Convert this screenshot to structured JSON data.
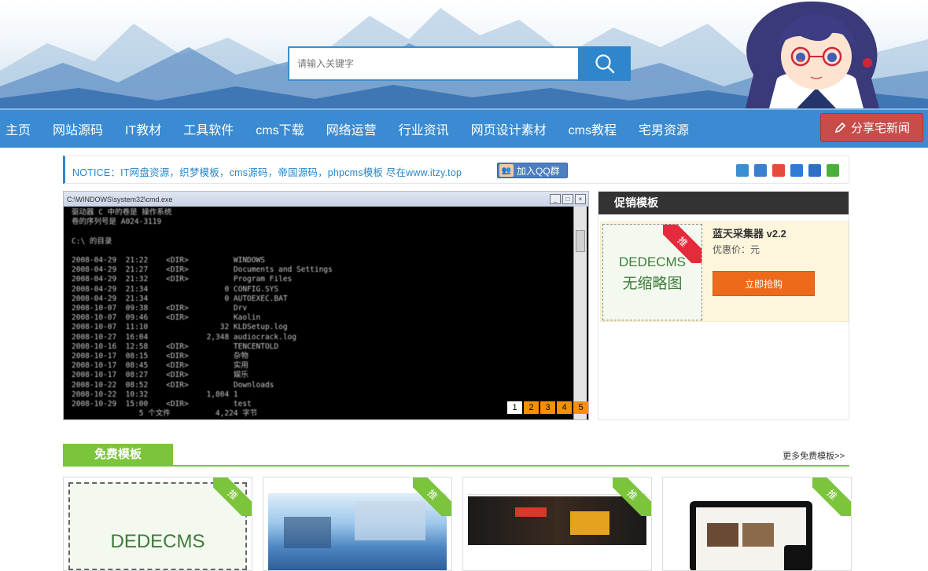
{
  "search": {
    "placeholder": "请输入关键字"
  },
  "nav": {
    "items": [
      "主页",
      "网站源码",
      "IT教材",
      "工具软件",
      "cms下载",
      "网络运营",
      "行业资讯",
      "网页设计素材",
      "cms教程",
      "宅男资源"
    ],
    "share_label": "分享宅新闻"
  },
  "notice": {
    "text": "NOTICE：IT网盘资源，织梦模板，cms源码，帝国源码，phpcms模板 尽在www.itzy.top",
    "qq_label": "加入QQ群"
  },
  "slider": {
    "window_title": "C:\\WINDOWS\\system32\\cmd.exe",
    "lines": [
      "驱动器 C 中的卷是 操作系统",
      "卷的序列号是 A024-3119",
      "",
      "C:\\ 的目录",
      "",
      "2008-04-29  21:22    <DIR>          WINDOWS",
      "2008-04-29  21:27    <DIR>          Documents and Settings",
      "2008-04-29  21:32    <DIR>          Program Files",
      "2008-04-29  21:34                 0 CONFIG.SYS",
      "2008-04-29  21:34                 0 AUTOEXEC.BAT",
      "2008-10-07  09:38    <DIR>          Drv",
      "2008-10-07  09:46    <DIR>          Kaolin",
      "2008-10-07  11:10                32 KLDSetup.log",
      "2008-10-27  16:04             2,348 audiocrack.log",
      "2008-10-16  12:58    <DIR>          TENCENTOLD",
      "2008-10-17  08:15    <DIR>          杂物",
      "2008-10-17  08:45    <DIR>          实用",
      "2008-10-17  08:27    <DIR>          娱乐",
      "2008-10-22  08:52    <DIR>          Downloads",
      "2008-10-22  10:32             1,804 1",
      "2008-10-29  15:00    <DIR>          test",
      "               5 个文件          4,224 字节"
    ],
    "pages": [
      "1",
      "2",
      "3",
      "4",
      "5"
    ]
  },
  "promo": {
    "header": "促销模板",
    "title": "蓝天采集器 v2.2",
    "price": "优惠价：元",
    "buy": "立即抢购",
    "thumb_line1": "DEDECMS",
    "thumb_line2": "无缩略图",
    "badge": "推"
  },
  "free": {
    "header": "免费模板",
    "more": "更多免费模板>>",
    "badge": "推",
    "tile1_line1": "DEDECMS"
  },
  "colors": {
    "nav": "#3a8bd1",
    "share": "#c74c4a",
    "accent_green": "#7cc43c",
    "buy": "#ee6a1b",
    "notice": "#2a86c8"
  }
}
